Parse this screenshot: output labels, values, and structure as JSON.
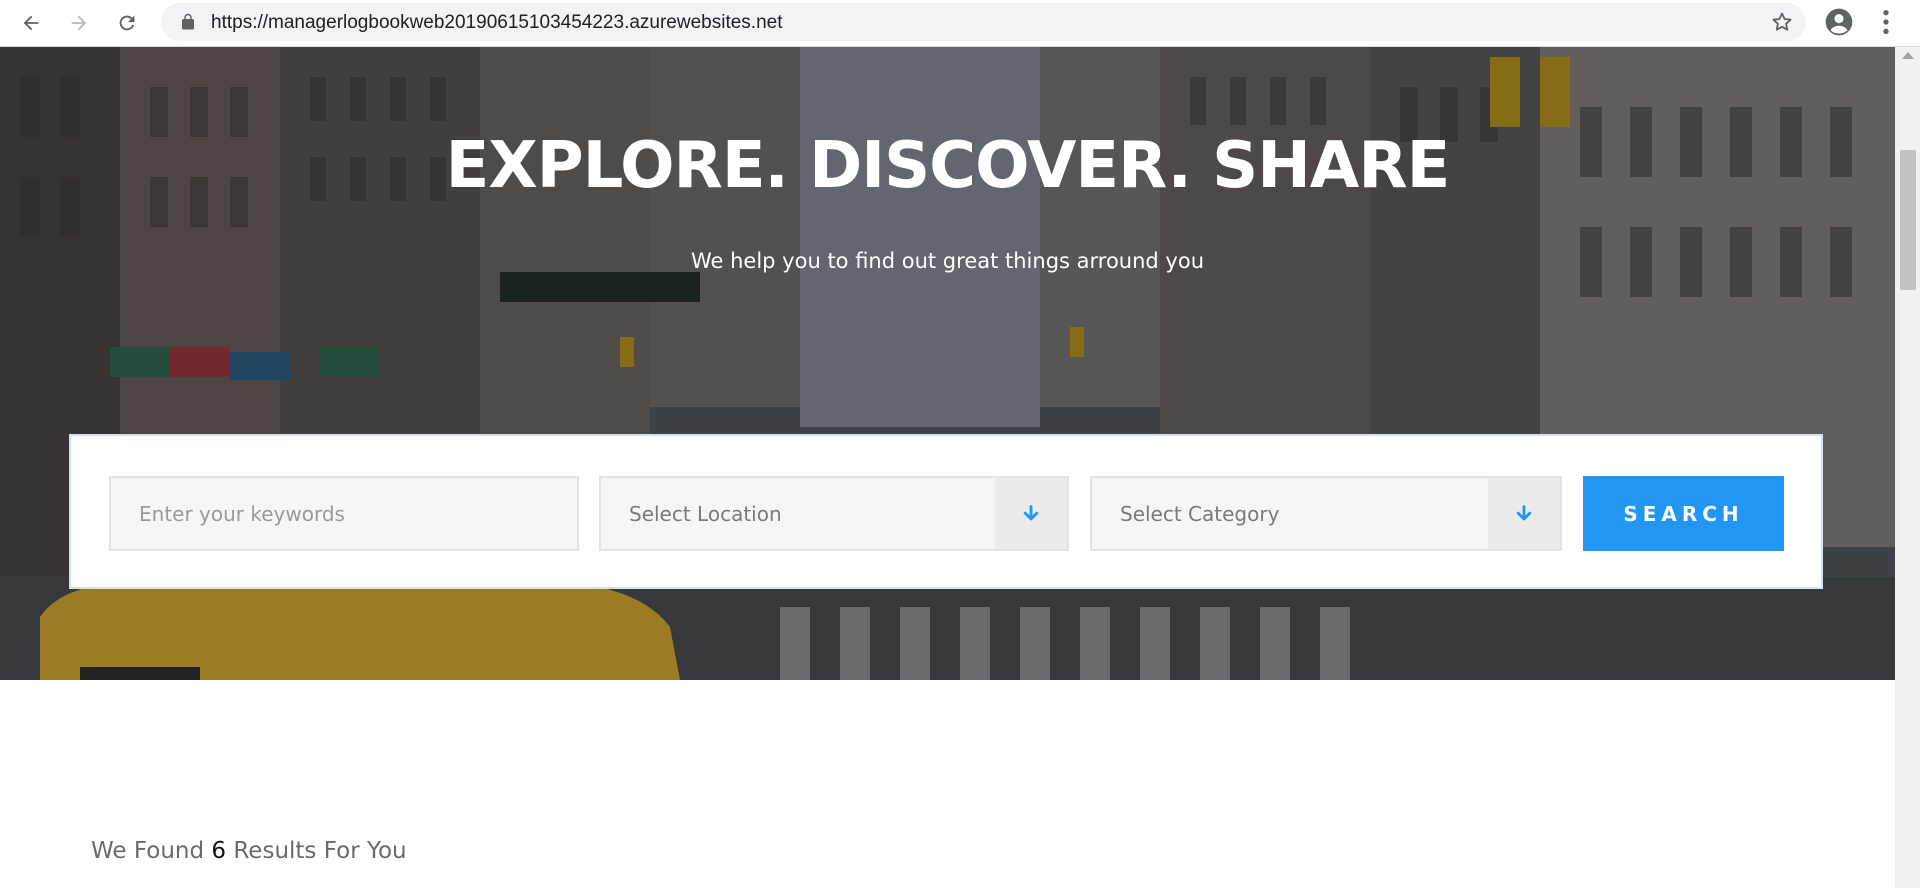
{
  "browser": {
    "url": "https://managerlogbookweb20190615103454223.azurewebsites.net"
  },
  "hero": {
    "title": "EXPLORE. DISCOVER. SHARE",
    "subtitle": "We help you to find out great things arround you"
  },
  "search": {
    "keywords_placeholder": "Enter your keywords",
    "location_label": "Select Location",
    "category_label": "Select Category",
    "button_label": "SEARCH",
    "accent_color": "#2196f3"
  },
  "results": {
    "prefix": "We Found",
    "count": "6",
    "suffix": "Results For You"
  }
}
